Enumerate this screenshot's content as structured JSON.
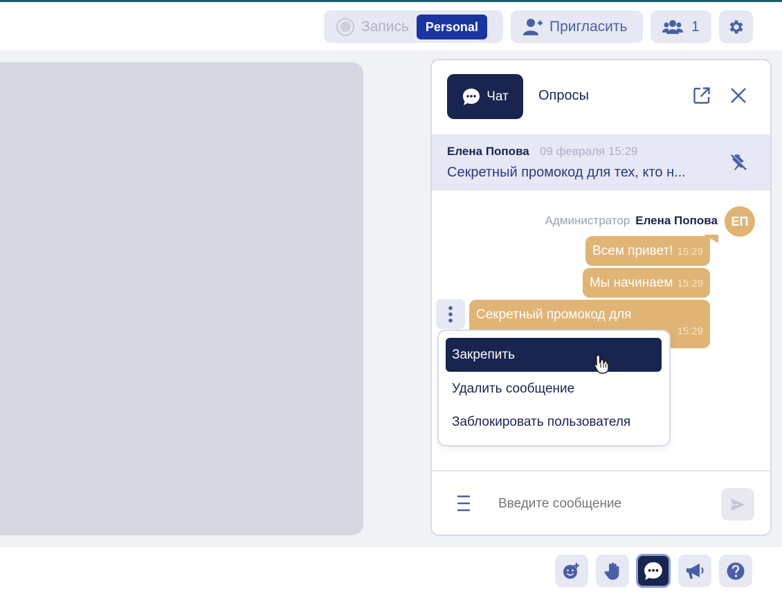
{
  "topbar": {
    "record_label": "Запись",
    "record_badge": "Personal",
    "invite_label": "Пригласить",
    "participants_count": "1"
  },
  "chat": {
    "tabs": [
      {
        "label": "Чат",
        "active": true
      },
      {
        "label": "Опросы",
        "active": false
      }
    ],
    "pinned": {
      "author": "Елена Попова",
      "date": "09 февраля 15:29",
      "text": "Секретный промокод для тех, кто н..."
    },
    "message_group": {
      "role": "Администратор",
      "author": "Елена Попова",
      "avatar_initials": "ЕП",
      "messages": [
        {
          "text": "Всем привет!",
          "time": "15:29"
        },
        {
          "text": "Мы начинаем",
          "time": "15:29"
        },
        {
          "text": "Секретный промокод для",
          "time": "15:29"
        }
      ]
    },
    "context_menu": {
      "items": [
        {
          "label": "Закрепить",
          "highlighted": true
        },
        {
          "label": "Удалить сообщение",
          "highlighted": false
        },
        {
          "label": "Заблокировать пользователя",
          "highlighted": false
        }
      ]
    },
    "input": {
      "placeholder": "Введите сообщение"
    }
  },
  "icons": {
    "settings": "gear-icon",
    "invite": "user-plus-icon",
    "participants": "users-icon",
    "chat_tab": "chat-bubble-icon",
    "popout": "external-link-icon",
    "close": "close-icon",
    "unpin": "unpin-icon",
    "more": "more-vertical-icon",
    "send": "send-icon",
    "bottom": [
      "emoji-plus-icon",
      "raise-hand-icon",
      "chat-bubble-icon",
      "megaphone-icon",
      "help-icon"
    ]
  },
  "colors": {
    "accent_dark": "#19244f",
    "brand_blue": "#1a34a0",
    "message_bubble": "#e0b474",
    "icon_blue": "#4a5fa5"
  }
}
